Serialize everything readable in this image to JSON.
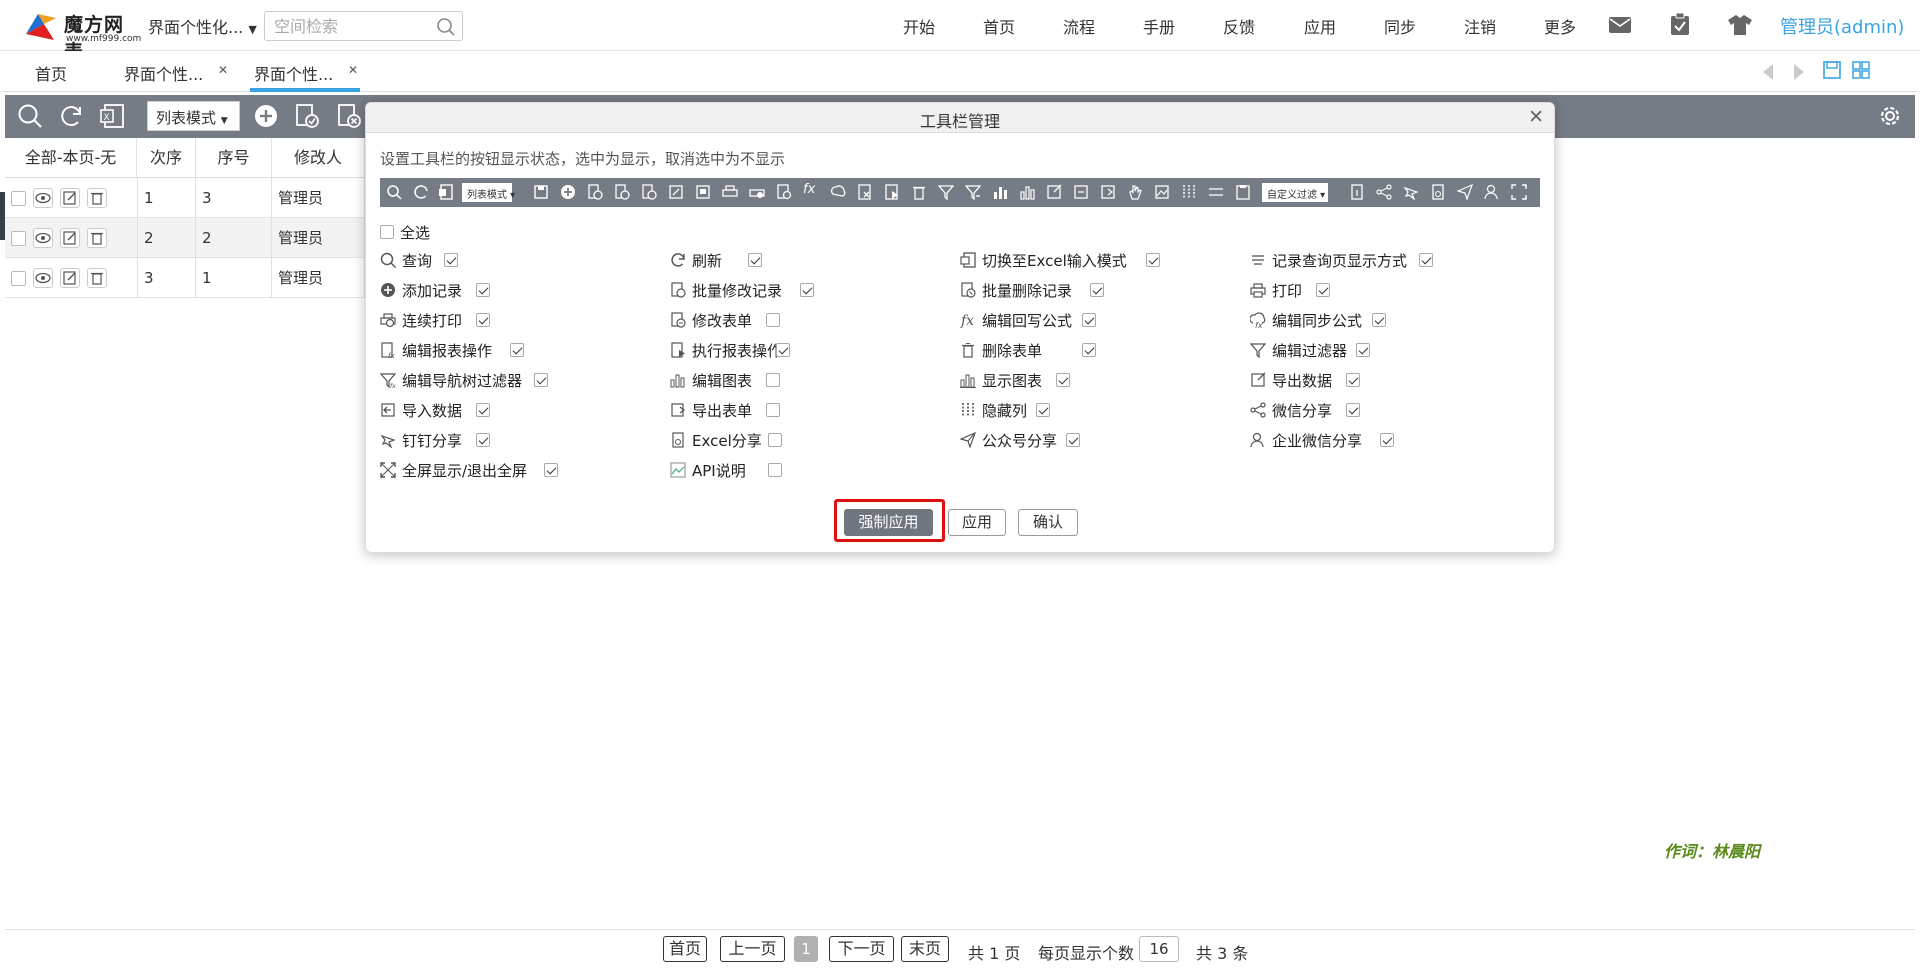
{
  "app": {
    "logo_title": "魔方网表",
    "logo_url": "www.mf999.com",
    "space_selector": "界面个性化...",
    "search_placeholder": "空间检索"
  },
  "nav": [
    "开始",
    "首页",
    "流程",
    "手册",
    "反馈",
    "应用",
    "同步",
    "注销",
    "更多"
  ],
  "nav_icons": [
    "mail-icon",
    "clipboard-icon",
    "shirt-icon"
  ],
  "user": "管理员(admin)",
  "tabs": [
    {
      "label": "首页"
    },
    {
      "label": "界面个性..."
    },
    {
      "label": "界面个性..."
    }
  ],
  "toolbar": {
    "mode": "列表模式"
  },
  "grid": {
    "headers": [
      "全部-本页-无",
      "次序",
      "序号",
      "修改人"
    ],
    "rows": [
      {
        "order": "1",
        "seq": "3",
        "modifier": "管理员"
      },
      {
        "order": "2",
        "seq": "2",
        "modifier": "管理员"
      },
      {
        "order": "3",
        "seq": "1",
        "modifier": "管理员"
      }
    ]
  },
  "modal": {
    "title": "工具栏管理",
    "desc": "设置工具栏的按钮显示状态，选中为显示，取消选中为不显示",
    "strip_mode": "列表模式",
    "strip_filter": "自定义过滤",
    "select_all": "全选",
    "options": [
      {
        "label": "查询",
        "checked": true,
        "icon": "search-icon"
      },
      {
        "label": "刷新",
        "checked": true,
        "icon": "refresh-icon"
      },
      {
        "label": "切换至Excel输入模式",
        "checked": true,
        "icon": "excel-icon"
      },
      {
        "label": "记录查询页显示方式",
        "checked": true,
        "icon": "list-icon"
      },
      {
        "label": "添加记录",
        "checked": true,
        "icon": "add-icon"
      },
      {
        "label": "批量修改记录",
        "checked": true,
        "icon": "batch-edit-icon"
      },
      {
        "label": "批量删除记录",
        "checked": true,
        "icon": "batch-delete-icon"
      },
      {
        "label": "打印",
        "checked": true,
        "icon": "print-icon"
      },
      {
        "label": "连续打印",
        "checked": true,
        "icon": "continuous-print-icon"
      },
      {
        "label": "修改表单",
        "checked": false,
        "icon": "edit-form-icon"
      },
      {
        "label": "编辑回写公式",
        "checked": true,
        "icon": "formula-icon"
      },
      {
        "label": "编辑同步公式",
        "checked": true,
        "icon": "sync-formula-icon"
      },
      {
        "label": "编辑报表操作",
        "checked": true,
        "icon": "report-edit-icon"
      },
      {
        "label": "执行报表操作",
        "checked": true,
        "icon": "report-run-icon"
      },
      {
        "label": "删除表单",
        "checked": true,
        "icon": "trash-icon"
      },
      {
        "label": "编辑过滤器",
        "checked": true,
        "icon": "filter-icon"
      },
      {
        "label": "编辑导航树过滤器",
        "checked": true,
        "icon": "nav-filter-icon"
      },
      {
        "label": "编辑图表",
        "checked": false,
        "icon": "chart-edit-icon"
      },
      {
        "label": "显示图表",
        "checked": true,
        "icon": "chart-show-icon"
      },
      {
        "label": "导出数据",
        "checked": true,
        "icon": "export-icon"
      },
      {
        "label": "导入数据",
        "checked": true,
        "icon": "import-icon"
      },
      {
        "label": "导出表单",
        "checked": false,
        "icon": "export-form-icon"
      },
      {
        "label": "隐藏列",
        "checked": true,
        "icon": "hide-column-icon"
      },
      {
        "label": "微信分享",
        "checked": true,
        "icon": "share-icon"
      },
      {
        "label": "钉钉分享",
        "checked": true,
        "icon": "dingtalk-icon"
      },
      {
        "label": "Excel分享",
        "checked": false,
        "icon": "excel-share-icon"
      },
      {
        "label": "公众号分享",
        "checked": true,
        "icon": "send-icon"
      },
      {
        "label": "企业微信分享",
        "checked": true,
        "icon": "enterprise-wechat-icon"
      },
      {
        "label": "全屏显示/退出全屏",
        "checked": true,
        "icon": "fullscreen-icon"
      },
      {
        "label": "API说明",
        "checked": false,
        "icon": "broken-image-icon"
      }
    ],
    "buttons": {
      "force_apply": "强制应用",
      "apply": "应用",
      "confirm": "确认"
    }
  },
  "pager": {
    "first": "首页",
    "prev": "上一页",
    "current": "1",
    "next": "下一页",
    "last": "末页",
    "total_pages": "共 1 页",
    "per_page_label": "每页显示个数",
    "per_page": "16",
    "total_items": "共 3 条"
  },
  "signature": "作词：林晨阳",
  "colors": {
    "toolbar_bg": "#767c85",
    "accent": "#3aa3e3",
    "highlight": "#e01010"
  }
}
